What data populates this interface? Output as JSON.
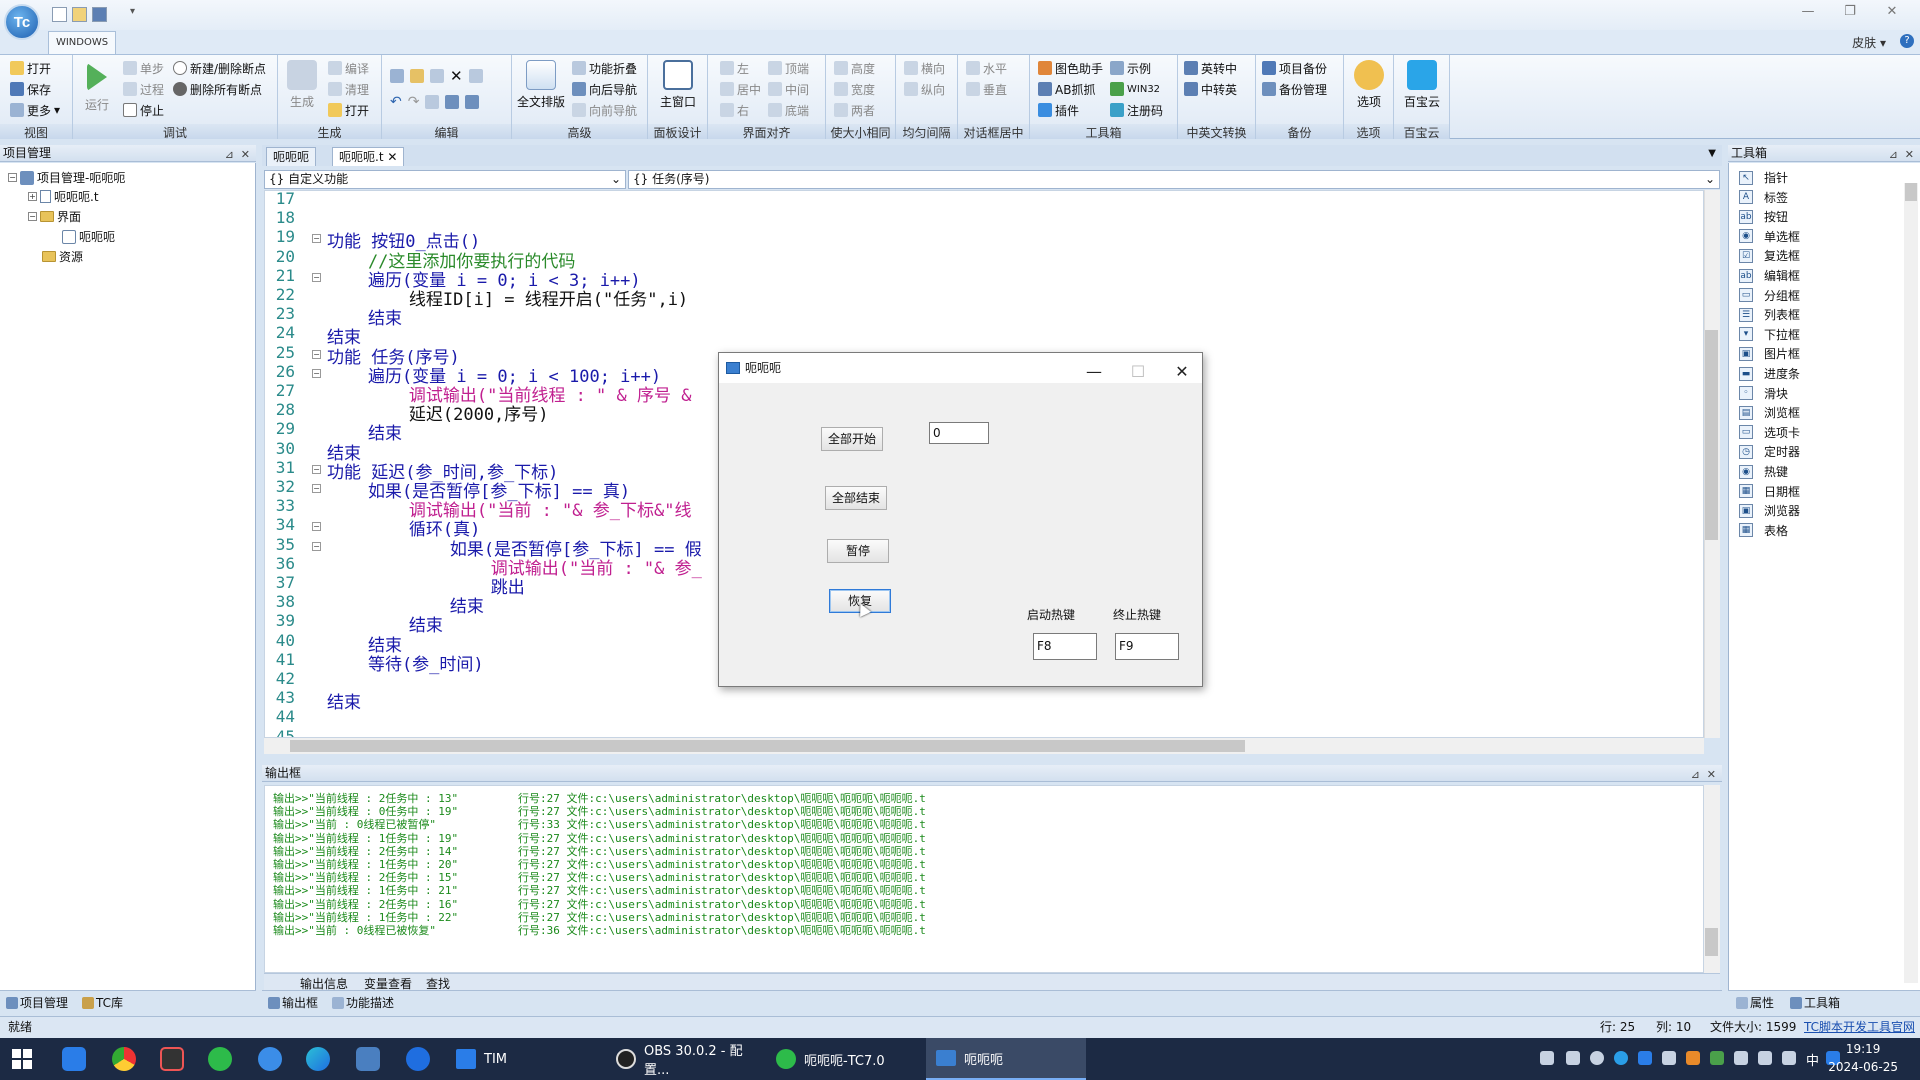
{
  "window": {
    "tab": "WINDOWS",
    "skin": "皮肤",
    "logo": "Tc"
  },
  "ribbon": {
    "groups": [
      {
        "label": "视图",
        "items": [
          "打开",
          "保存",
          "更多"
        ]
      },
      {
        "label": "调试",
        "big": "运行",
        "items": [
          "单步",
          "过程",
          "停止",
          "新建/删除断点",
          "删除所有断点"
        ]
      },
      {
        "label": "生成",
        "big": "生成",
        "items": [
          "编译",
          "清理",
          "打开"
        ]
      },
      {
        "label": "编辑",
        "items": []
      },
      {
        "label": "高级",
        "big": "全文排版",
        "items": [
          "功能折叠",
          "向后导航",
          "向前导航"
        ]
      },
      {
        "label": "面板设计",
        "big": "主窗口",
        "items": []
      },
      {
        "label": "界面对齐",
        "items": [
          "左",
          "居中",
          "右",
          "顶端",
          "中间",
          "底端"
        ]
      },
      {
        "label": "使大小相同",
        "items": [
          "高度",
          "宽度",
          "两者"
        ]
      },
      {
        "label": "均匀间隔",
        "items": [
          "横向",
          "纵向"
        ]
      },
      {
        "label": "对话框居中",
        "items": [
          "水平",
          "垂直"
        ]
      },
      {
        "label": "工具箱",
        "items": [
          "图色助手",
          "AB抓抓",
          "插件",
          "示例",
          "WIN32",
          "注册码"
        ]
      },
      {
        "label": "中英文转换",
        "items": [
          "英转中",
          "中转英"
        ]
      },
      {
        "label": "备份",
        "items": [
          "项目备份",
          "备份管理"
        ]
      },
      {
        "label": "选项",
        "big": "选项",
        "items": []
      },
      {
        "label": "百宝云",
        "big": "百宝云",
        "items": []
      }
    ]
  },
  "project_panel": {
    "title": "项目管理",
    "tree": [
      "项目管理-呃呃呃",
      "呃呃呃.t",
      "界面",
      "呃呃呃",
      "资源"
    ],
    "bottom_tabs": [
      "项目管理",
      "TC库"
    ]
  },
  "editor": {
    "tabs": [
      "呃呃呃",
      "呃呃呃.t"
    ],
    "combo_left": "{} 自定义功能",
    "combo_right": "{} 任务(序号)",
    "line_numbers": [
      "17",
      "18",
      "19",
      "20",
      "21",
      "22",
      "23",
      "24",
      "25",
      "26",
      "27",
      "28",
      "29",
      "30",
      "31",
      "32",
      "33",
      "34",
      "35",
      "36",
      "37",
      "38",
      "39",
      "40",
      "41",
      "42",
      "43",
      "44",
      "45"
    ],
    "lines": [
      "",
      "",
      "功能 按钮0_点击()",
      "    //这里添加你要执行的代码",
      "    遍历(变量 i = 0; i < 3; i++)",
      "        线程ID[i] = 线程开启(\"任务\",i)",
      "    结束",
      "结束",
      "功能 任务(序号)",
      "    遍历(变量 i = 0; i < 100; i++)",
      "        调试输出(\"当前线程 : \" & 序号 &",
      "        延迟(2000,序号)",
      "    结束",
      "结束",
      "功能 延迟(参_时间,参_下标)",
      "    如果(是否暂停[参_下标] == 真)",
      "        调试输出(\"当前 : \"& 参_下标&\"线",
      "        循环(真)",
      "            如果(是否暂停[参_下标] == 假",
      "                调试输出(\"当前 : \"& 参_",
      "                跳出",
      "            结束",
      "        结束",
      "    结束",
      "    等待(参_时间)",
      "",
      "结束",
      "",
      ""
    ]
  },
  "dialog": {
    "title": "呃呃呃",
    "btn_start_all": "全部开始",
    "btn_end_all": "全部结束",
    "btn_pause": "暂停",
    "btn_resume": "恢复",
    "input_value": "0",
    "label_start_hotkey": "启动热键",
    "label_stop_hotkey": "终止热键",
    "start_hotkey": "F8",
    "stop_hotkey": "F9"
  },
  "output": {
    "title": "输出框",
    "lines": [
      {
        "msg": "输出>>\"当前线程 : 2任务中 : 13\"",
        "loc": "行号:27 文件:c:\\users\\administrator\\desktop\\呃呃呃\\呃呃呃\\呃呃呃.t"
      },
      {
        "msg": "输出>>\"当前线程 : 0任务中 : 19\"",
        "loc": "行号:27 文件:c:\\users\\administrator\\desktop\\呃呃呃\\呃呃呃\\呃呃呃.t"
      },
      {
        "msg": "输出>>\"当前 : 0线程已被暂停\"",
        "loc": "行号:33 文件:c:\\users\\administrator\\desktop\\呃呃呃\\呃呃呃\\呃呃呃.t"
      },
      {
        "msg": "输出>>\"当前线程 : 1任务中 : 19\"",
        "loc": "行号:27 文件:c:\\users\\administrator\\desktop\\呃呃呃\\呃呃呃\\呃呃呃.t"
      },
      {
        "msg": "输出>>\"当前线程 : 2任务中 : 14\"",
        "loc": "行号:27 文件:c:\\users\\administrator\\desktop\\呃呃呃\\呃呃呃\\呃呃呃.t"
      },
      {
        "msg": "输出>>\"当前线程 : 1任务中 : 20\"",
        "loc": "行号:27 文件:c:\\users\\administrator\\desktop\\呃呃呃\\呃呃呃\\呃呃呃.t"
      },
      {
        "msg": "输出>>\"当前线程 : 2任务中 : 15\"",
        "loc": "行号:27 文件:c:\\users\\administrator\\desktop\\呃呃呃\\呃呃呃\\呃呃呃.t"
      },
      {
        "msg": "输出>>\"当前线程 : 1任务中 : 21\"",
        "loc": "行号:27 文件:c:\\users\\administrator\\desktop\\呃呃呃\\呃呃呃\\呃呃呃.t"
      },
      {
        "msg": "输出>>\"当前线程 : 2任务中 : 16\"",
        "loc": "行号:27 文件:c:\\users\\administrator\\desktop\\呃呃呃\\呃呃呃\\呃呃呃.t"
      },
      {
        "msg": "输出>>\"当前线程 : 1任务中 : 22\"",
        "loc": "行号:27 文件:c:\\users\\administrator\\desktop\\呃呃呃\\呃呃呃\\呃呃呃.t"
      },
      {
        "msg": "输出>>\"当前 : 0线程已被恢复\"",
        "loc": "行号:36 文件:c:\\users\\administrator\\desktop\\呃呃呃\\呃呃呃\\呃呃呃.t"
      }
    ],
    "sub_tabs": [
      "输出信息",
      "变量查看",
      "查找"
    ],
    "bottom_tabs": [
      "输出框",
      "功能描述"
    ]
  },
  "toolbox": {
    "title": "工具箱",
    "items": [
      "指针",
      "标签",
      "按钮",
      "单选框",
      "复选框",
      "编辑框",
      "分组框",
      "列表框",
      "下拉框",
      "图片框",
      "进度条",
      "滑块",
      "浏览框",
      "选项卡",
      "定时器",
      "热键",
      "日期框",
      "浏览器",
      "表格"
    ],
    "bottom_tabs": [
      "属性",
      "工具箱"
    ]
  },
  "status": {
    "left": "就绪",
    "row": "行: 25",
    "col": "列: 10",
    "size": "文件大小: 1599",
    "link": "TC脚本开发工具官网"
  },
  "taskbar": {
    "apps": [
      "TIM",
      "OBS 30.0.2 - 配置...",
      "呃呃呃-TC7.0",
      "呃呃呃"
    ],
    "time": "19:19",
    "date": "2024-06-25",
    "ime": "中"
  }
}
